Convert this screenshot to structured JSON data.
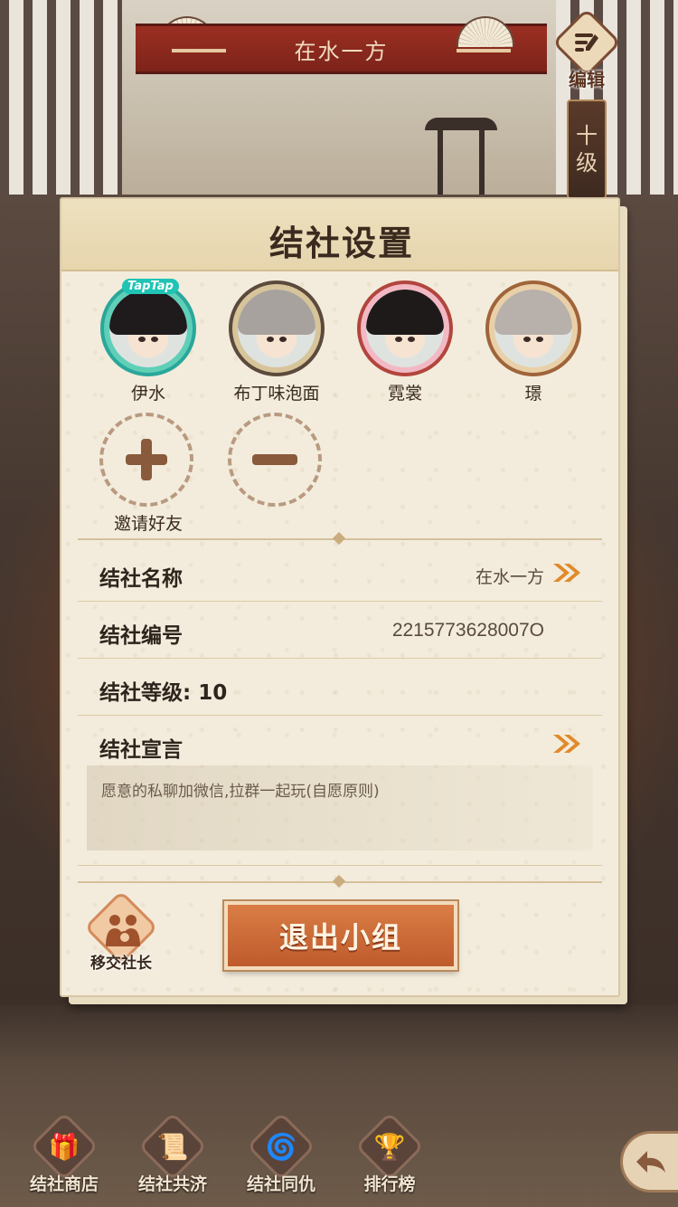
{
  "top_bar": {
    "title": "在水一方",
    "edit_label": "编辑",
    "level_tag": [
      "十",
      "级"
    ]
  },
  "dialog": {
    "title": "结社设置",
    "members": [
      {
        "name": "伊水",
        "badge": "TapTap"
      },
      {
        "name": "布丁味泡面"
      },
      {
        "name": "霓裳"
      },
      {
        "name": "璟"
      }
    ],
    "invite_label": "邀请好友",
    "rows": {
      "name_label": "结社名称",
      "name_value": "在水一方",
      "id_label": "结社编号",
      "id_value": "2215773628007O",
      "level_label": "结社等级: 10",
      "declaration_label": "结社宣言",
      "declaration_text": "愿意的私聊加微信,拉群一起玩(自愿原则)"
    },
    "transfer_label": "移交社长",
    "exit_label": "退出小组"
  },
  "bottom_nav": [
    {
      "label": "结社商店",
      "icon": "gift-icon"
    },
    {
      "label": "结社共济",
      "icon": "scroll-icon"
    },
    {
      "label": "结社同仇",
      "icon": "swirl-icon"
    },
    {
      "label": "排行榜",
      "icon": "ranking-icon"
    }
  ],
  "colors": {
    "banner": "#8a281d",
    "card": "#f3ecdc",
    "exit_button": "#c9652f",
    "text": "#2e241c"
  }
}
